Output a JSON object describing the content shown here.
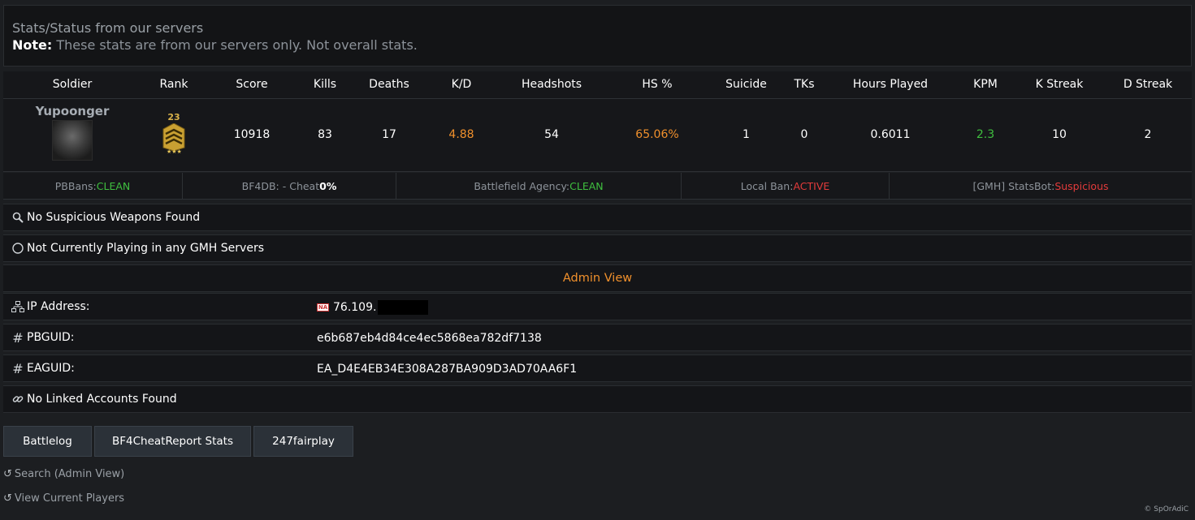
{
  "note": {
    "title": "Stats/Status from our servers",
    "label": "Note:",
    "text": " These stats are from our servers only. Not overall stats."
  },
  "table": {
    "headers": [
      "Soldier",
      "Rank",
      "Score",
      "Kills",
      "Deaths",
      "K/D",
      "Headshots",
      "HS %",
      "Suicide",
      "TKs",
      "Hours Played",
      "KPM",
      "K Streak",
      "D Streak"
    ],
    "row": {
      "soldier": "Yupoonger",
      "rank": "23",
      "score": "10918",
      "kills": "83",
      "deaths": "17",
      "kd": "4.88",
      "headshots": "54",
      "hs_pct": "65.06%",
      "suicide": "1",
      "tks": "0",
      "hours_played": "0.6011",
      "kpm": "2.3",
      "k_streak": "10",
      "d_streak": "2"
    }
  },
  "status": {
    "pbbans": {
      "label": "PBBans: ",
      "value": "CLEAN"
    },
    "bf4db": {
      "label": "BF4DB: - Cheat ",
      "value": "0%"
    },
    "agency": {
      "label": "Battlefield Agency: ",
      "value": "CLEAN"
    },
    "localban": {
      "label": "Local Ban: ",
      "value": "ACTIVE"
    },
    "statsbot": {
      "label": "[GMH] StatsBot: ",
      "value": "Suspicious"
    }
  },
  "weapons_text": "No Suspicious Weapons Found",
  "playing_text": "Not Currently Playing in any GMH Servers",
  "admin": {
    "header": "Admin View",
    "ip_label": "IP Address:",
    "ip_flag": "NA",
    "ip_value": "76.109.",
    "pbguid_label": "PBGUID:",
    "pbguid_value": "e6b687eb4d84ce4ec5868ea782df7138",
    "eaguid_label": "EAGUID:",
    "eaguid_value": "EA_D4E4EB34E308A287BA909D3AD70AA6F1",
    "linked_text": "No Linked Accounts Found"
  },
  "buttons": {
    "battlelog": "Battlelog",
    "bf4cheatreport": "BF4CheatReport Stats",
    "fairplay": "247fairplay"
  },
  "links": {
    "search": "Search (Admin View)",
    "current": "View Current Players"
  },
  "credit": "© SpOrAdiC",
  "colors": {
    "accent_orange": "#f0902c",
    "clean_green": "#3fbf3f",
    "alert_red": "#e33b3b"
  },
  "icons": {
    "search": "search-icon",
    "circle": "circle-icon",
    "network": "network-icon",
    "hash": "hash-icon",
    "link": "link-icon",
    "refresh": "refresh-icon"
  }
}
